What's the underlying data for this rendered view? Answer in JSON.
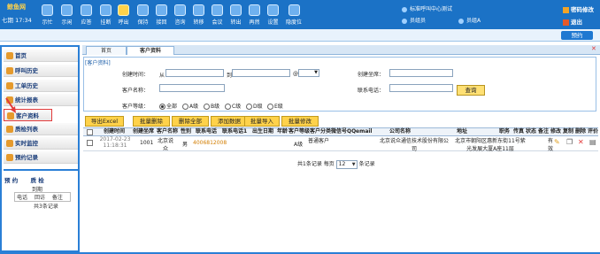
{
  "header": {
    "logo": "鲸鱼网",
    "clock": "七期 17:34",
    "toolbar": [
      "示忙",
      "示闲",
      "应答",
      "挂断",
      "呼出",
      "保持",
      "接回",
      "咨询",
      "转移",
      "会议",
      "转出",
      "再然",
      "设置",
      "隐度位"
    ],
    "sysinfo_title": "标准呼叫中心测试",
    "user1": "员组员",
    "user2": "员组A",
    "change_password": "密码修改",
    "logout": "退出",
    "reserve": "预约"
  },
  "sidebar": {
    "items": [
      "首页",
      "呼叫历史",
      "工单历史",
      "统计报表",
      "客户资料",
      "质检列表",
      "实时监控",
      "预约记录"
    ],
    "appointment": {
      "tab1": "预 约",
      "tab2": "质 检",
      "header": "到期",
      "cols": [
        "电话",
        "回访",
        "备注"
      ],
      "total": "共3条记录"
    }
  },
  "tabs": {
    "home": "首页",
    "customer": "客户资料"
  },
  "filters": {
    "legend": "[客户资料]",
    "create_time_label": "创建时间：",
    "from": "从",
    "to": "到",
    "at_sign": "@",
    "creator_label": "创建坐席：",
    "customer_name_label": "客户名称：",
    "phone_label": "联系电话：",
    "level_label": "客户等级：",
    "levels": [
      "全部",
      "A级",
      "B级",
      "C级",
      "D级",
      "E级"
    ],
    "selected_level": "全部",
    "query": "查询"
  },
  "actions": [
    "导出Excel",
    "批量删除",
    "删除全部",
    "添加数据",
    "批量导入",
    "批量修改"
  ],
  "table": {
    "columns": [
      "创建时间",
      "创建坐席",
      "客户名称",
      "性别",
      "联系电话",
      "联系电话1",
      "出生日期",
      "年龄",
      "客户等级",
      "客户分类",
      "微信号",
      "QQ",
      "email",
      "公司名称",
      "地址",
      "职务",
      "传真",
      "状态",
      "备注",
      "修改",
      "复制",
      "删除",
      "评价"
    ],
    "rows": [
      {
        "create_time": "2017-02-23 11:18:31",
        "creator": "1001",
        "name": "北京说众",
        "gender": "男",
        "phone": "4006812008",
        "phone1": "",
        "birth": "",
        "age": "",
        "level": "A级",
        "category": "普通客户",
        "wechat": "",
        "qq": "",
        "email": "",
        "company": "北京说众通信技术股份有限公司",
        "address": "北京市朝阳区惠新东街11号紫光发展大厦A座11层",
        "position": "",
        "fax": "",
        "status": "有效",
        "remark": ""
      }
    ]
  },
  "pager": {
    "total_text": "共1条记录 每页",
    "page_size": "12",
    "suffix": "条记录"
  },
  "colors": {
    "header_blue": "#1b72c6",
    "accent_yellow": "#ffd24a",
    "highlight_red": "#e23a3a"
  }
}
